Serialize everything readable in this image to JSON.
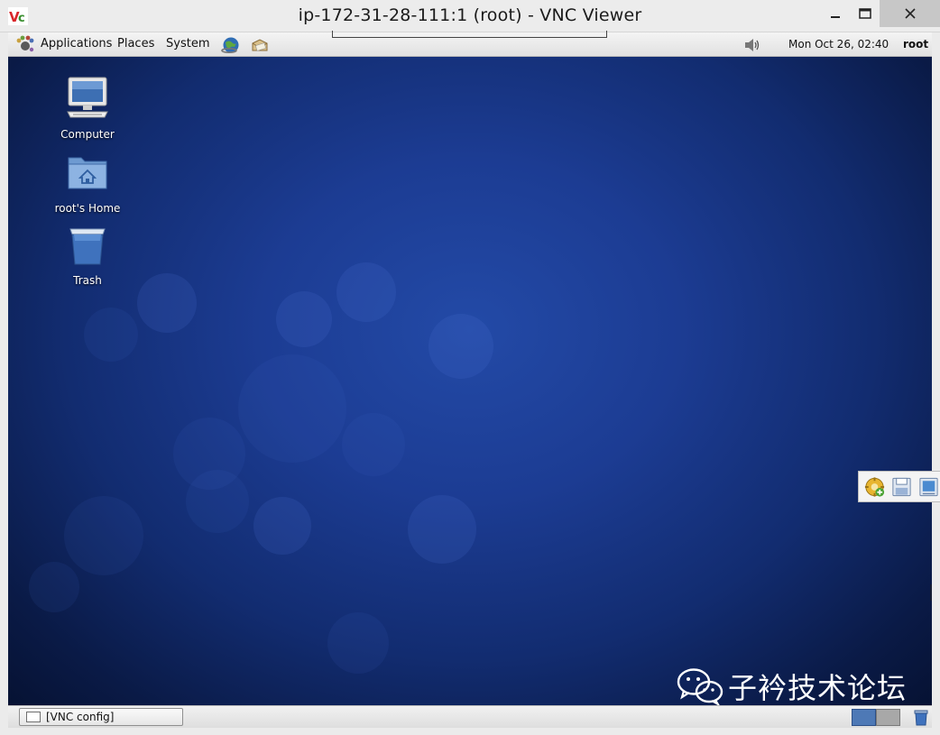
{
  "window": {
    "title": "ip-172-31-28-111:1 (root) - VNC Viewer"
  },
  "top_panel": {
    "menus": [
      "Applications",
      "Places",
      "System"
    ],
    "clock": "Mon Oct 26, 02:40",
    "user": "root"
  },
  "desktop": {
    "icons": [
      {
        "label": "Computer",
        "icon": "computer-icon"
      },
      {
        "label": "root's Home",
        "icon": "home-folder-icon"
      },
      {
        "label": "Trash",
        "icon": "trash-icon"
      }
    ]
  },
  "bottom_panel": {
    "task": "[VNC config]"
  },
  "watermark": {
    "text": "子衿技术论坛"
  },
  "colors": {
    "desktop_bg": "#1c3c93",
    "workspace_active": "#4e79b6"
  }
}
